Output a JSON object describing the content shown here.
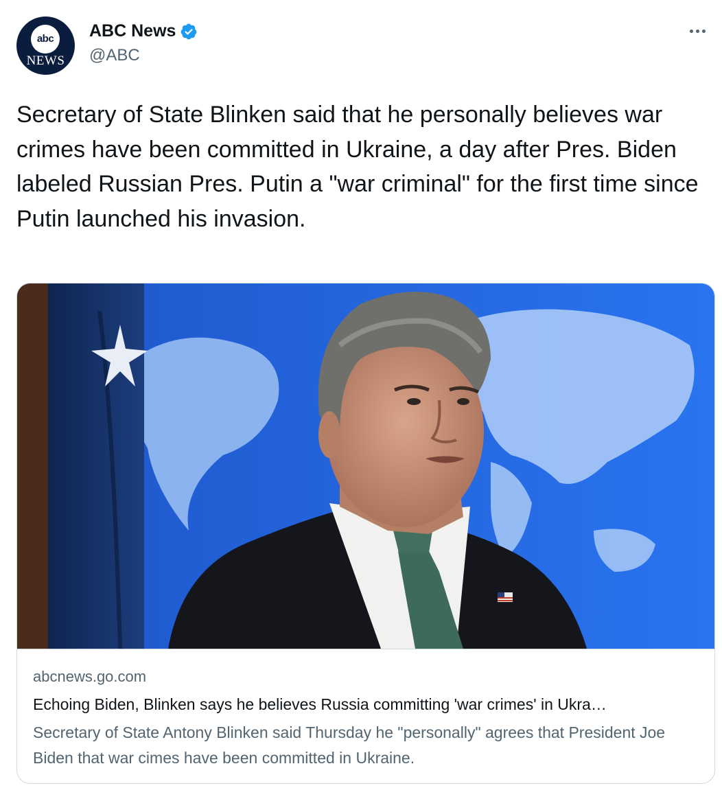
{
  "account": {
    "avatar_logo_text": "abc",
    "avatar_news_text": "NEWS",
    "display_name": "ABC News",
    "handle": "@ABC",
    "verified_icon": "verified-badge-icon"
  },
  "menu": {
    "more_icon": "more-horizontal-icon"
  },
  "tweet": {
    "text": "Secretary of State Blinken said that he personally believes war crimes have been committed in Ukraine, a day after Pres. Biden labeled Russian Pres. Putin a \"war criminal\" for the first time since Putin launched his invasion."
  },
  "card": {
    "domain": "abcnews.go.com",
    "title": "Echoing Biden, Blinken says he believes Russia committing 'war crimes' in Ukra…",
    "description": "Secretary of State Antony Blinken said Thursday he \"personally\" agrees that President Joe Biden that war cimes have been committed in Ukraine."
  },
  "colors": {
    "accent": "#1d9bf0",
    "text_primary": "#0f1419",
    "text_secondary": "#536471",
    "border": "#cfd9de",
    "image_bg": "#1a5fe0"
  }
}
